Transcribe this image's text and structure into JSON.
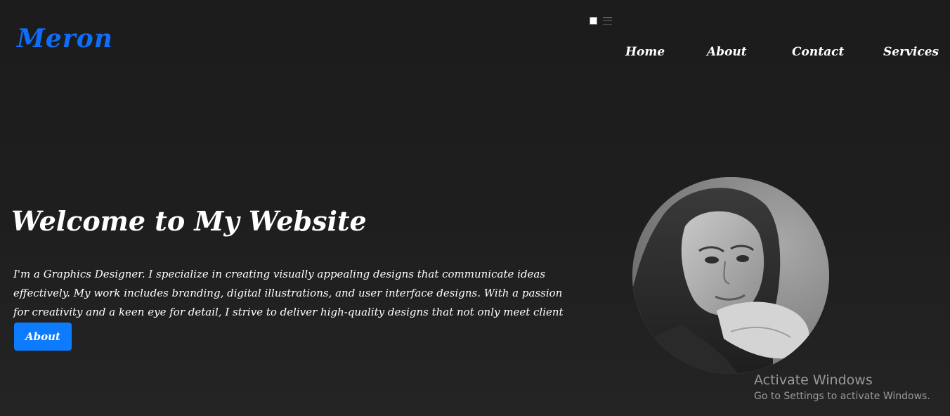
{
  "header": {
    "logo": "Meron"
  },
  "nav": {
    "items": [
      {
        "label": "Home"
      },
      {
        "label": "About"
      },
      {
        "label": "Contact"
      },
      {
        "label": "Services"
      }
    ]
  },
  "hero": {
    "title": "Welcome to My Website",
    "description": "I'm a Graphics Designer. I specialize in creating visually appealing designs that communicate ideas effectively. My work includes branding, digital illustrations, and user interface designs. With a passion for creativity and a keen eye for detail, I strive to deliver high-quality designs that not only meet client",
    "button_label": "About"
  },
  "watermark": {
    "title": "Activate Windows",
    "subtitle": "Go to Settings to activate Windows."
  },
  "colors": {
    "accent": "#0d6efd",
    "background": "#1e1e1e",
    "text": "#ffffff"
  },
  "icons": {
    "toggle_square": "square-icon",
    "toggle_menu": "menu-lines-icon"
  }
}
